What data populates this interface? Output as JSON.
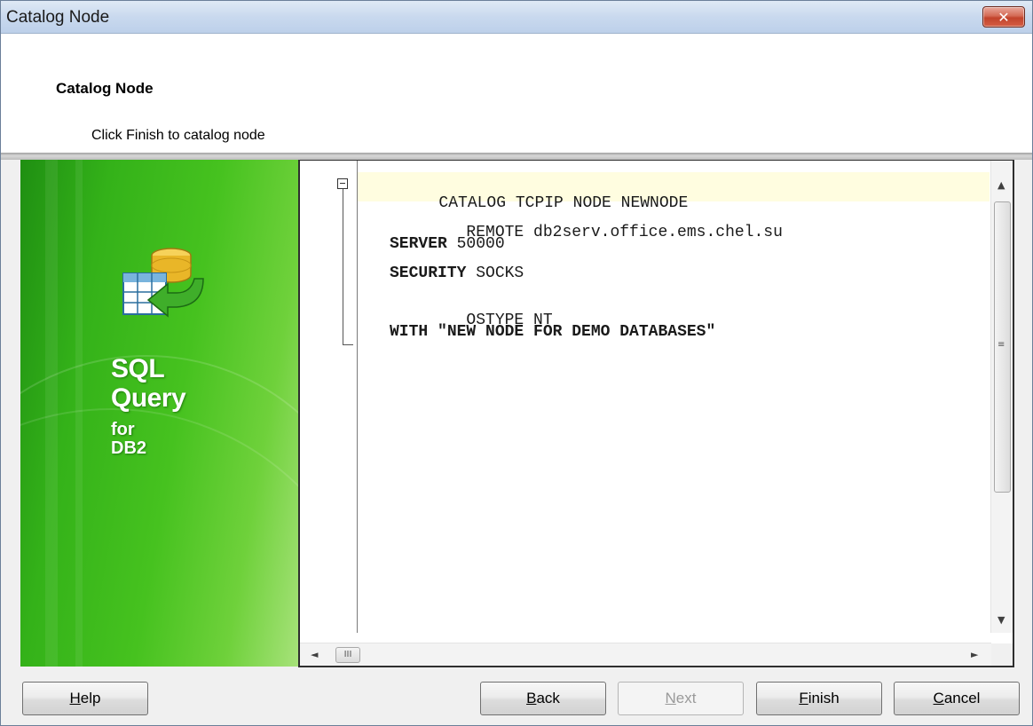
{
  "window": {
    "title": "Catalog Node",
    "close_glyph": "✕"
  },
  "header": {
    "title": "Catalog Node",
    "subtitle": "Click Finish to catalog node"
  },
  "banner": {
    "line1": "SQL",
    "line2": "Query",
    "line3": "for",
    "line4": "DB2",
    "icon": "database-table-arrow-icon"
  },
  "editor": {
    "lines": [
      {
        "keyword": "",
        "text": "CATALOG TCPIP NODE NEWNODE"
      },
      {
        "keyword": "",
        "text": "REMOTE db2serv.office.ems.chel.su"
      },
      {
        "keyword": "SERVER",
        "text": " 50000"
      },
      {
        "keyword": "SECURITY",
        "text": " SOCKS"
      },
      {
        "keyword": "",
        "text": "OSTYPE NT"
      },
      {
        "keyword": "WITH",
        "text": " \"NEW NODE FOR DEMO DATABASES\""
      }
    ],
    "scroll": {
      "up": "▲",
      "down": "▼",
      "left": "◄",
      "right": "►",
      "vgrip": "≡",
      "hgrip": "III"
    }
  },
  "buttons": {
    "help": {
      "accel": "H",
      "rest": "elp"
    },
    "back": {
      "accel": "B",
      "rest": "ack"
    },
    "next": {
      "accel": "N",
      "rest": "ext"
    },
    "finish": {
      "accel": "F",
      "rest": "inish"
    },
    "cancel": {
      "accel": "C",
      "rest": "ancel"
    }
  }
}
